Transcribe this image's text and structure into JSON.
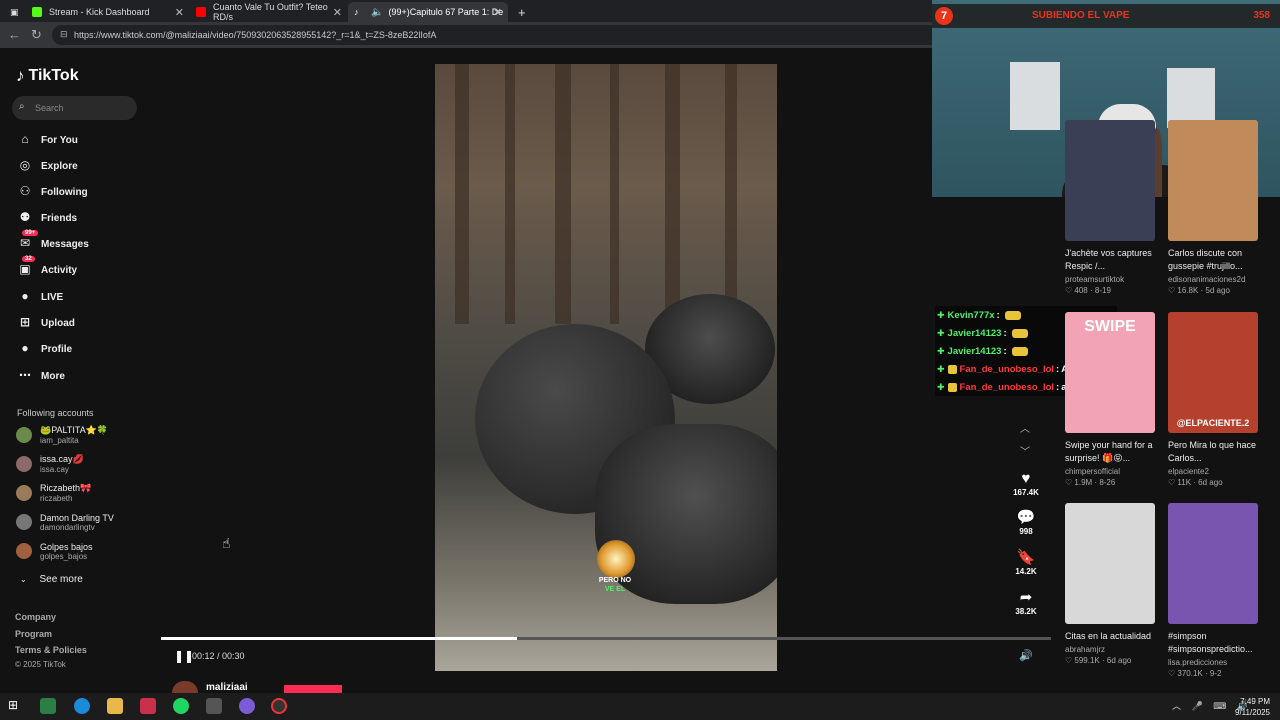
{
  "tabs": [
    {
      "title": "Stream - Kick Dashboard",
      "color": "#53fc18"
    },
    {
      "title": "Cuanto Vale Tu Outfit? Teteo RD/s",
      "color": "#ff0000"
    },
    {
      "title": "(99+)Capitulo 67 Parte 1: De",
      "color": "#ffffff"
    }
  ],
  "url": "https://www.tiktok.com/@maliziaai/video/7509302063528955142?_r=1&_t=ZS-8zeB22lIofA",
  "sidebar": {
    "logo": "TikTok",
    "search_placeholder": "Search",
    "nav": [
      {
        "label": "For You",
        "icon": "home-icon",
        "glyph": "⌂"
      },
      {
        "label": "Explore",
        "icon": "compass-icon",
        "glyph": "◎"
      },
      {
        "label": "Following",
        "icon": "following-icon",
        "glyph": "⚇"
      },
      {
        "label": "Friends",
        "icon": "friends-icon",
        "glyph": "⚉"
      },
      {
        "label": "Messages",
        "icon": "messages-icon",
        "glyph": "✉",
        "badge": "99+"
      },
      {
        "label": "Activity",
        "icon": "activity-icon",
        "glyph": "▣",
        "badge": "32"
      },
      {
        "label": "LIVE",
        "icon": "live-icon",
        "glyph": "●"
      },
      {
        "label": "Upload",
        "icon": "upload-icon",
        "glyph": "⊞"
      },
      {
        "label": "Profile",
        "icon": "profile-icon",
        "glyph": "●"
      },
      {
        "label": "More",
        "icon": "more-icon",
        "glyph": "⋯"
      }
    ],
    "following_title": "Following accounts",
    "accounts": [
      {
        "name": "🐸PALTITA⭐🍀",
        "handle": "iam_paltita"
      },
      {
        "name": "issa.cay💋",
        "handle": "issa.cay"
      },
      {
        "name": "Riczabeth🎀",
        "handle": "riczabeth"
      },
      {
        "name": "Damon Darling TV",
        "handle": "damondarlingtv"
      },
      {
        "name": "Golpes bajos",
        "handle": "golpes_bajos"
      }
    ],
    "see_more": "See more",
    "footer": [
      "Company",
      "Program",
      "Terms & Policies"
    ],
    "copyright": "© 2025 TikTok"
  },
  "video": {
    "caption_line1": "PERO NO",
    "caption_line2": "VE EL",
    "time": "00:12 / 00:30",
    "progress": 0.4,
    "uploader": "maliziaai"
  },
  "actions": [
    {
      "icon": "heart-icon",
      "glyph": "♥",
      "count": "167.4K"
    },
    {
      "icon": "comment-icon",
      "glyph": "💬",
      "count": "998"
    },
    {
      "icon": "bookmark-icon",
      "glyph": "🔖",
      "count": "14.2K"
    },
    {
      "icon": "share-icon",
      "glyph": "➦",
      "count": "38.2K"
    }
  ],
  "grid": [
    {
      "title": "J'achète vos captures Respic /...",
      "author": "proteamsurtiktok",
      "likes": "408",
      "date": "8-19",
      "color": "#3a3f55"
    },
    {
      "title": "Carlos discute con gussepie #trujillo...",
      "author": "edisonanimaciones2d",
      "likes": "16.8K",
      "date": "5d ago",
      "color": "#c08a5a"
    },
    {
      "title": "Swipe your hand for a surprise! 🎁😝...",
      "author": "chimpersofficial",
      "likes": "1.9M",
      "date": "8-26",
      "color": "#f2a3b5",
      "overlay": "SWIPE"
    },
    {
      "title": "Pero Mira lo que hace Carlos...",
      "author": "elpaciente2",
      "likes": "11K",
      "date": "6d ago",
      "color": "#b5402e",
      "overlay": "@ELPACIENTE.2"
    },
    {
      "title": "Citas en la actualidad",
      "author": "abrahamjrz",
      "likes": "599.1K",
      "date": "6d ago",
      "color": "#d8d8d8"
    },
    {
      "title": "#simpson #simpsonspredictio...",
      "author": "lisa.predicciones",
      "likes": "370.1K",
      "date": "9-2",
      "color": "#7a55b0"
    }
  ],
  "stream": {
    "badge": "7",
    "title": "SUBIENDO EL VAPE",
    "right": "358"
  },
  "chat": [
    {
      "user": "Kevin777x",
      "color": "#4ef26a",
      "text": ""
    },
    {
      "user": "Javier14123",
      "color": "#4ef26a",
      "text": ""
    },
    {
      "user": "Javier14123",
      "color": "#4ef26a",
      "text": ""
    },
    {
      "user": "Fan_de_unobeso_lol",
      "color": "#ff3a3a",
      "text": "Akakakkak"
    },
    {
      "user": "Fan_de_unobeso_lol",
      "color": "#ff3a3a",
      "text": "akakaka"
    }
  ],
  "clock": {
    "time": "7:49 PM",
    "date": "9/11/2025"
  }
}
